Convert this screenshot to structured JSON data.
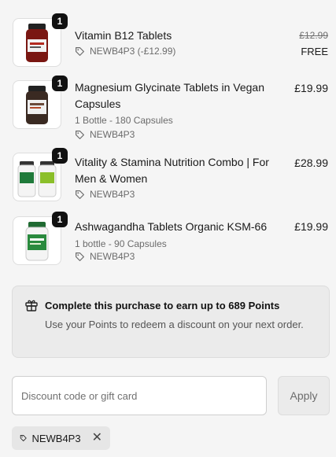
{
  "items": [
    {
      "qty": "1",
      "name": "Vitamin B12 Tablets",
      "discount": "NEWB4P3 (-£12.99)",
      "original_price": "£12.99",
      "price": "FREE",
      "image_icon": "supplement-bottle-red"
    },
    {
      "qty": "1",
      "name": "Magnesium Glycinate Tablets in Vegan Capsules",
      "variant": "1 Bottle - 180 Capsules",
      "discount": "NEWB4P3",
      "price": "£19.99",
      "image_icon": "supplement-bottle-brown"
    },
    {
      "qty": "1",
      "name": "Vitality & Stamina Nutrition Combo | For Men & Women",
      "discount": "NEWB4P3",
      "price": "£28.99",
      "image_icon": "supplement-bottles-green-pair"
    },
    {
      "qty": "1",
      "name": "Ashwagandha Tablets Organic KSM-66",
      "variant": "1 bottle - 90 Capsules",
      "discount": "NEWB4P3",
      "price": "£19.99",
      "image_icon": "supplement-bottle-green"
    }
  ],
  "points": {
    "title": "Complete this purchase to earn up to 689 Points",
    "description": "Use your Points to redeem a discount on your next order.",
    "icon": "gift-icon"
  },
  "discount_field": {
    "placeholder": "Discount code or gift card",
    "value": "",
    "apply_label": "Apply"
  },
  "applied_code": {
    "code": "NEWB4P3",
    "icon": "tag-icon",
    "remove_icon": "close-icon"
  },
  "colors": {
    "background": "#f5f5f5",
    "badge": "#111111",
    "muted_text": "#6b6b6b",
    "panel": "#ebebeb"
  }
}
